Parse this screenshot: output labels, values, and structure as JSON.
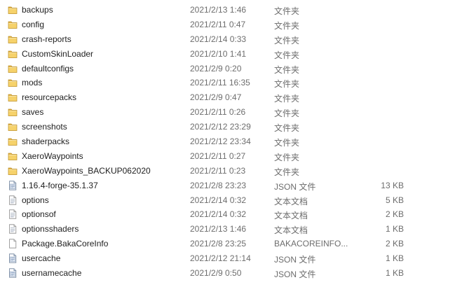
{
  "rows": [
    {
      "name": "backups",
      "date": "2021/2/13 1:46",
      "type": "文件夹",
      "size": "",
      "icon": "folder"
    },
    {
      "name": "config",
      "date": "2021/2/11 0:47",
      "type": "文件夹",
      "size": "",
      "icon": "folder"
    },
    {
      "name": "crash-reports",
      "date": "2021/2/14 0:33",
      "type": "文件夹",
      "size": "",
      "icon": "folder"
    },
    {
      "name": "CustomSkinLoader",
      "date": "2021/2/10 1:41",
      "type": "文件夹",
      "size": "",
      "icon": "folder"
    },
    {
      "name": "defaultconfigs",
      "date": "2021/2/9 0:20",
      "type": "文件夹",
      "size": "",
      "icon": "folder"
    },
    {
      "name": "mods",
      "date": "2021/2/11 16:35",
      "type": "文件夹",
      "size": "",
      "icon": "folder"
    },
    {
      "name": "resourcepacks",
      "date": "2021/2/9 0:47",
      "type": "文件夹",
      "size": "",
      "icon": "folder"
    },
    {
      "name": "saves",
      "date": "2021/2/11 0:26",
      "type": "文件夹",
      "size": "",
      "icon": "folder"
    },
    {
      "name": "screenshots",
      "date": "2021/2/12 23:29",
      "type": "文件夹",
      "size": "",
      "icon": "folder"
    },
    {
      "name": "shaderpacks",
      "date": "2021/2/12 23:34",
      "type": "文件夹",
      "size": "",
      "icon": "folder"
    },
    {
      "name": "XaeroWaypoints",
      "date": "2021/2/11 0:27",
      "type": "文件夹",
      "size": "",
      "icon": "folder"
    },
    {
      "name": "XaeroWaypoints_BACKUP062020",
      "date": "2021/2/11 0:23",
      "type": "文件夹",
      "size": "",
      "icon": "folder"
    },
    {
      "name": "1.16.4-forge-35.1.37",
      "date": "2021/2/8 23:23",
      "type": "JSON 文件",
      "size": "13 KB",
      "icon": "json-file"
    },
    {
      "name": "options",
      "date": "2021/2/14 0:32",
      "type": "文本文档",
      "size": "5 KB",
      "icon": "text-file"
    },
    {
      "name": "optionsof",
      "date": "2021/2/14 0:32",
      "type": "文本文档",
      "size": "2 KB",
      "icon": "text-file"
    },
    {
      "name": "optionsshaders",
      "date": "2021/2/13 1:46",
      "type": "文本文档",
      "size": "1 KB",
      "icon": "text-file"
    },
    {
      "name": "Package.BakaCoreInfo",
      "date": "2021/2/8 23:25",
      "type": "BAKACOREINFO...",
      "size": "2 KB",
      "icon": "blank-file"
    },
    {
      "name": "usercache",
      "date": "2021/2/12 21:14",
      "type": "JSON 文件",
      "size": "1 KB",
      "icon": "json-file"
    },
    {
      "name": "usernamecache",
      "date": "2021/2/9 0:50",
      "type": "JSON 文件",
      "size": "1 KB",
      "icon": "json-file"
    }
  ]
}
